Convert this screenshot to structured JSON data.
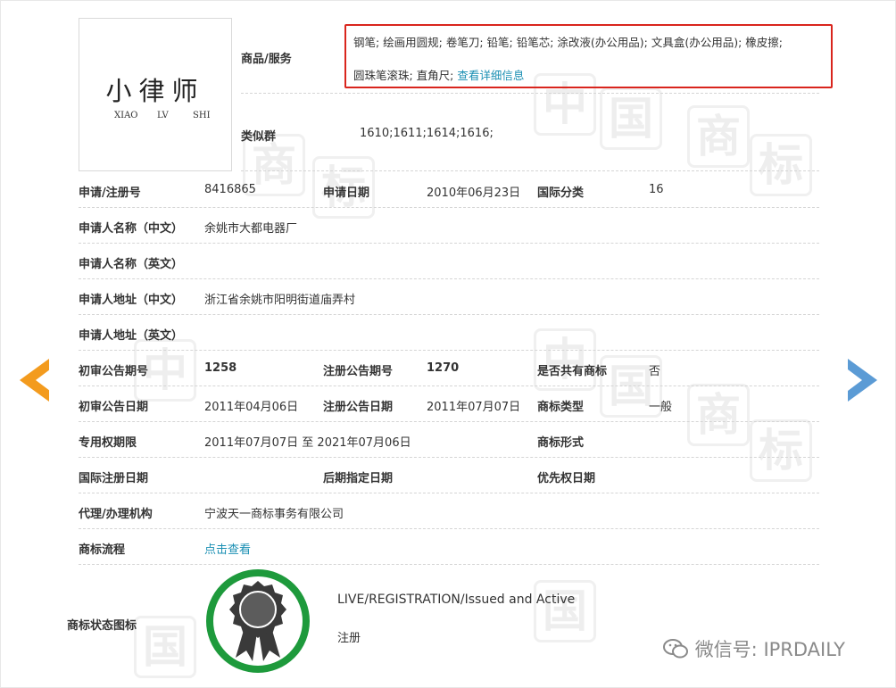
{
  "trademark": {
    "logo_text_cn": "小律师",
    "logo_pinyin": [
      "XIAO",
      "LV",
      "SHI"
    ]
  },
  "goods": {
    "label": "商品/服务",
    "line1": "钢笔; 绘画用圆规; 卷笔刀; 铅笔; 铅笔芯; 涂改液(办公用品); 文具盒(办公用品); 橡皮擦;",
    "line2": "圆珠笔滚珠; 直角尺;",
    "detail_link": "查看详细信息"
  },
  "similar_group": {
    "label": "类似群",
    "value": "1610;1611;1614;1616;"
  },
  "fields": {
    "reg_no_label": "申请/注册号",
    "reg_no": "8416865",
    "apply_date_label": "申请日期",
    "apply_date": "2010年06月23日",
    "intl_class_label": "国际分类",
    "intl_class": "16",
    "applicant_cn_label": "申请人名称（中文）",
    "applicant_cn": "余姚市大都电器厂",
    "applicant_en_label": "申请人名称（英文）",
    "address_cn_label": "申请人地址（中文）",
    "address_cn": "浙江省余姚市阳明街道庙弄村",
    "address_en_label": "申请人地址（英文）",
    "prelim_no_label": "初审公告期号",
    "prelim_no": "1258",
    "reg_pub_no_label": "注册公告期号",
    "reg_pub_no": "1270",
    "shared_label": "是否共有商标",
    "shared": "否",
    "prelim_date_label": "初审公告日期",
    "prelim_date": "2011年04月06日",
    "reg_pub_date_label": "注册公告日期",
    "reg_pub_date": "2011年07月07日",
    "tm_type_label": "商标类型",
    "tm_type": "一般",
    "exclusive_label": "专用权期限",
    "exclusive": "2011年07月07日 至 2021年07月06日",
    "tm_form_label": "商标形式",
    "intl_reg_label": "国际注册日期",
    "later_label": "后期指定日期",
    "priority_label": "优先权日期",
    "agent_label": "代理/办理机构",
    "agent": "宁波天一商标事务有限公司",
    "process_label": "商标流程",
    "process_link": "点击查看",
    "status_label": "商标状态图标",
    "status_en": "LIVE/REGISTRATION/Issued and Active",
    "status_cn": "注册"
  },
  "watermark": {
    "text": "微信号: IPRDAILY",
    "chars": [
      "中",
      "国",
      "商",
      "标"
    ]
  },
  "nav": {
    "prev_icon": "arrow-left-icon",
    "next_icon": "arrow-right-icon"
  },
  "colors": {
    "highlight_border": "#d9251d",
    "link": "#1a8fb3",
    "badge_ring": "#1e9a3c",
    "prev_arrow": "#f39b1e",
    "next_arrow": "#5b9bd5"
  }
}
